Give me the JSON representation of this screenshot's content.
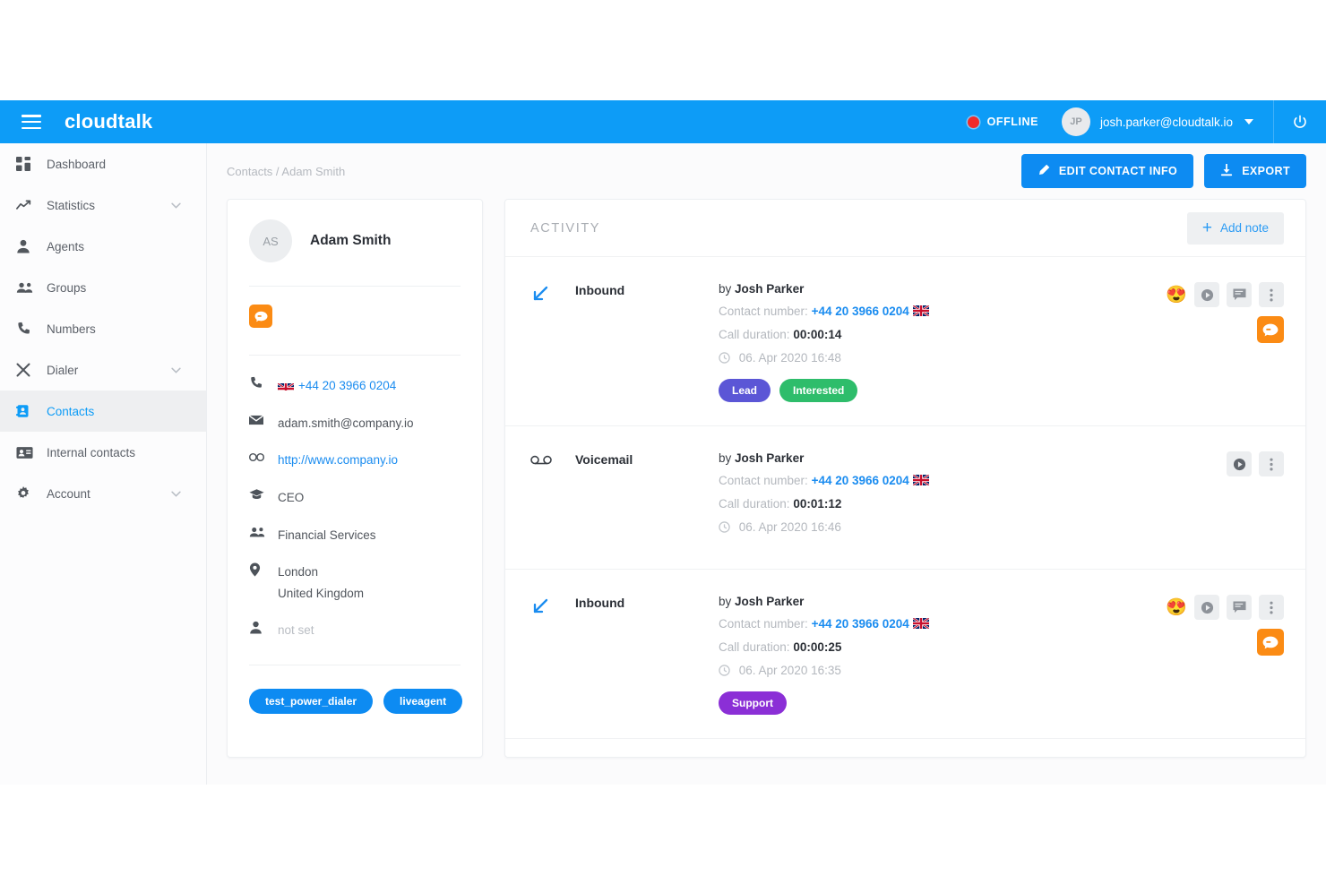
{
  "topbar": {
    "brand": "cloudtalk",
    "menu_icon": "hamburger-icon",
    "status_label": "OFFLINE",
    "status_color": "#f02b2b",
    "user_initials": "JP",
    "user_email": "josh.parker@cloudtalk.io",
    "power_icon": "power-icon",
    "accent": "#0d9cf7"
  },
  "sidebar": {
    "items": [
      {
        "label": "Dashboard",
        "icon": "dashboard-grid-icon",
        "expandable": false,
        "active": false
      },
      {
        "label": "Statistics",
        "icon": "trending-up-icon",
        "expandable": true,
        "active": false
      },
      {
        "label": "Agents",
        "icon": "person-icon",
        "expandable": false,
        "active": false
      },
      {
        "label": "Groups",
        "icon": "people-icon",
        "expandable": false,
        "active": false
      },
      {
        "label": "Numbers",
        "icon": "phone-icon",
        "expandable": false,
        "active": false
      },
      {
        "label": "Dialer",
        "icon": "shuffle-icon",
        "expandable": true,
        "active": false
      },
      {
        "label": "Contacts",
        "icon": "contact-card-icon",
        "expandable": false,
        "active": true
      },
      {
        "label": "Internal contacts",
        "icon": "id-badge-icon",
        "expandable": false,
        "active": false
      },
      {
        "label": "Account",
        "icon": "gear-icon",
        "expandable": true,
        "active": false
      }
    ]
  },
  "breadcrumb": "Contacts / Adam Smith",
  "actions": {
    "edit_label": "EDIT CONTACT INFO",
    "edit_icon": "pencil-icon",
    "export_label": "EXPORT",
    "export_icon": "download-icon"
  },
  "contact": {
    "initials": "AS",
    "name": "Adam Smith",
    "integration_icon": "liveagent-chat-icon",
    "details": [
      {
        "icon": "phone-icon",
        "value": "+44 20 3966 0204",
        "style": "link",
        "flag": "gb"
      },
      {
        "icon": "envelope-icon",
        "value": "adam.smith@company.io",
        "style": "text",
        "flag": ""
      },
      {
        "icon": "link-icon",
        "value": "http://www.company.io",
        "style": "link",
        "flag": ""
      },
      {
        "icon": "graduation-cap-icon",
        "value": "CEO",
        "style": "text",
        "flag": ""
      },
      {
        "icon": "people-icon",
        "value": "Financial Services",
        "style": "text",
        "flag": ""
      },
      {
        "icon": "location-pin-icon",
        "value": "London\nUnited Kingdom",
        "style": "text",
        "flag": ""
      },
      {
        "icon": "person-icon",
        "value": "not set",
        "style": "muted",
        "flag": ""
      }
    ],
    "tags": [
      "test_power_dialer",
      "liveagent"
    ]
  },
  "activity": {
    "title": "ACTIVITY",
    "add_note_label": "Add note",
    "add_note_icon": "plus-icon",
    "labels": {
      "contact_number": "Contact number:",
      "call_duration": "Call duration:",
      "by": "by"
    },
    "entries": [
      {
        "direction_icon": "arrow-inbound-icon",
        "type": "Inbound",
        "agent": "Josh Parker",
        "contact_number": "+44 20 3966 0204",
        "flag": "gb",
        "duration": "00:00:14",
        "timestamp": "06. Apr 2020 16:48",
        "tags": [
          {
            "label": "Lead",
            "color": "#5b56d6"
          },
          {
            "label": "Interested",
            "color": "#2ebd6b"
          }
        ],
        "sentiment": "heart-eyes-emoji",
        "buttons": [
          "play-icon",
          "note-icon",
          "more-vertical-icon"
        ],
        "integration": "liveagent-chat-icon"
      },
      {
        "direction_icon": "voicemail-icon",
        "type": "Voicemail",
        "agent": "Josh Parker",
        "contact_number": "+44 20 3966 0204",
        "flag": "gb",
        "duration": "00:01:12",
        "timestamp": "06. Apr 2020 16:46",
        "tags": [],
        "sentiment": "",
        "buttons": [
          "play-icon",
          "more-vertical-icon"
        ],
        "integration": ""
      },
      {
        "direction_icon": "arrow-inbound-icon",
        "type": "Inbound",
        "agent": "Josh Parker",
        "contact_number": "+44 20 3966 0204",
        "flag": "gb",
        "duration": "00:00:25",
        "timestamp": "06. Apr 2020 16:35",
        "tags": [
          {
            "label": "Support",
            "color": "#8b2fd6"
          }
        ],
        "sentiment": "heart-eyes-emoji",
        "buttons": [
          "play-icon",
          "note-icon",
          "more-vertical-icon"
        ],
        "integration": "liveagent-chat-icon"
      }
    ]
  }
}
